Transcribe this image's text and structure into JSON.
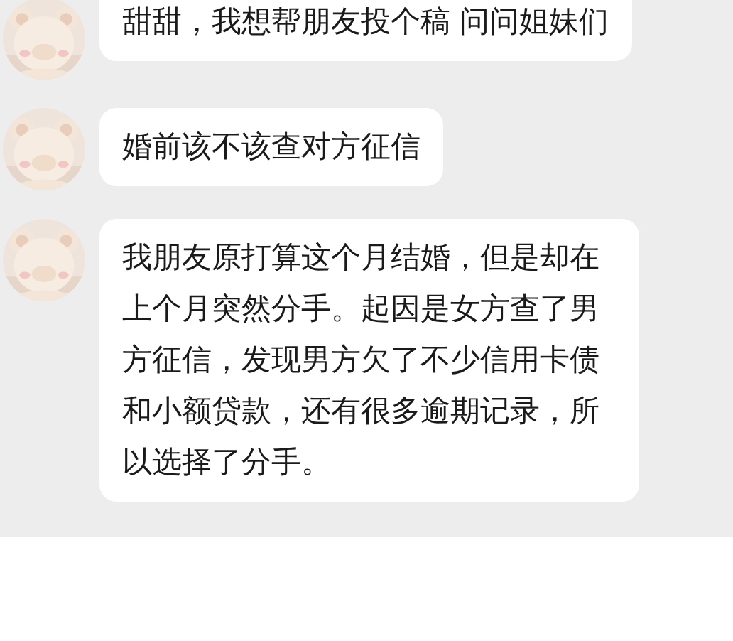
{
  "messages": [
    {
      "text": "甜甜，我想帮朋友投个稿 问问姐妹们"
    },
    {
      "text": "婚前该不该查对方征信"
    },
    {
      "text": "我朋友原打算这个月结婚，但是却在上个月突然分手。起因是女方查了男方征信，发现男方欠了不少信用卡债和小额贷款，还有很多逾期记录，所以选择了分手。"
    }
  ]
}
